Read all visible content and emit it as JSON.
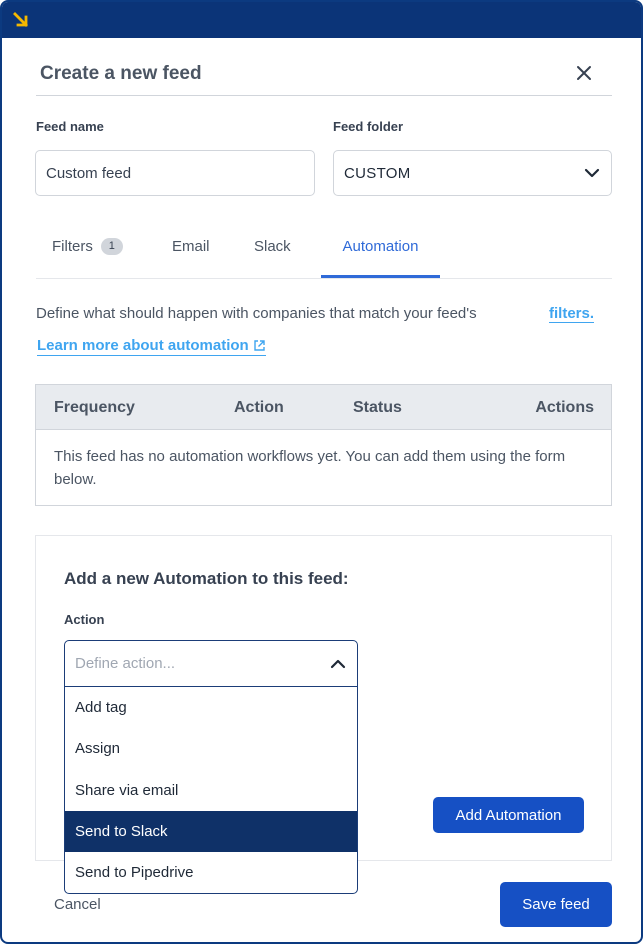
{
  "modal": {
    "title": "Create a new feed"
  },
  "form": {
    "feed_name_label": "Feed name",
    "feed_name_value": "Custom feed",
    "feed_folder_label": "Feed folder",
    "feed_folder_value": "CUSTOM"
  },
  "tabs": [
    {
      "label": "Filters",
      "badge": "1"
    },
    {
      "label": "Email"
    },
    {
      "label": "Slack"
    },
    {
      "label": "Automation",
      "active": true
    }
  ],
  "automation": {
    "description": "Define what should happen with companies that match your feed's",
    "filters_link": "filters.",
    "learn_more": "Learn more about automation"
  },
  "table": {
    "columns": [
      "Frequency",
      "Action",
      "Status",
      "Actions"
    ],
    "empty_message": "This feed has no automation workflows yet. You can add them using the form below."
  },
  "add_panel": {
    "title": "Add a new Automation to this feed:",
    "action_label": "Action",
    "action_placeholder": "Define action...",
    "options": [
      "Add tag",
      "Assign",
      "Share via email",
      "Send to Slack",
      "Send to Pipedrive"
    ],
    "highlighted_option": "Send to Slack",
    "add_button": "Add Automation"
  },
  "footer": {
    "cancel": "Cancel",
    "save": "Save feed"
  },
  "colors": {
    "topbar": "#0b3478",
    "accent": "#2f6ad8",
    "primary_button": "#1650c4",
    "link": "#3fa5f0",
    "logo": "#f5b800"
  },
  "icons": {
    "logo": "arrow-down-right-icon",
    "close": "close-icon",
    "folder_select": "chevron-down-icon",
    "dropdown_toggle": "chevron-up-icon",
    "external_link": "external-link-icon"
  }
}
